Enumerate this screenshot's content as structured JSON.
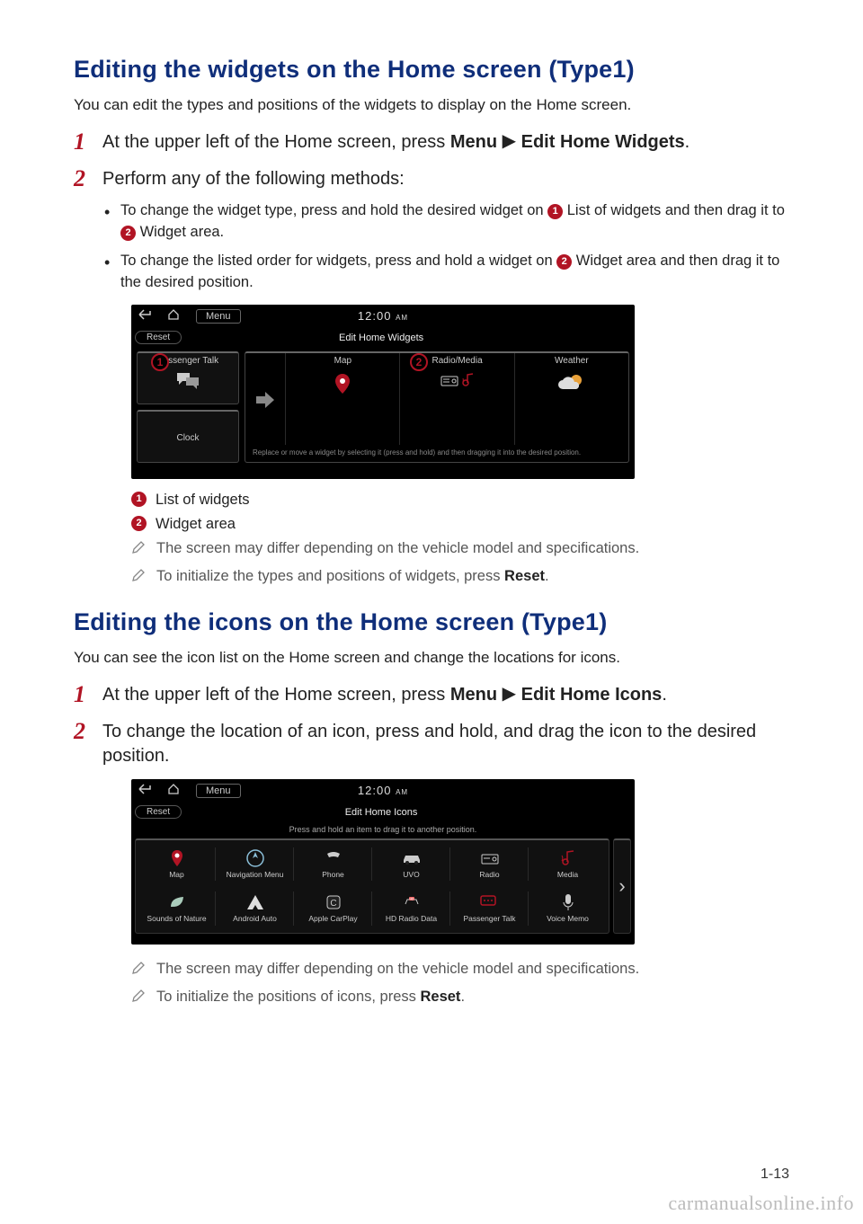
{
  "section1": {
    "heading": "Editing the widgets on the Home screen (Type1)",
    "lead": "You can edit the types and positions of the widgets to display on the Home screen.",
    "step1_pre": "At the upper left of the Home screen, press ",
    "step1_b1": "Menu",
    "arrow": "▶",
    "step1_b2": "Edit Home Widgets",
    "step1_post": ".",
    "step2": "Perform any of the following methods:",
    "sub1_a": "To change the widget type, press and hold the desired widget on ",
    "sub1_b": " List of widgets and then drag it to ",
    "sub1_c": " Widget area.",
    "sub2_a": "To change the listed order for widgets, press and hold a widget on ",
    "sub2_b": " Widget area and then drag it to the desired position.",
    "badge1": "1",
    "badge2": "2",
    "legend1": "List of widgets",
    "legend2": "Widget area",
    "note1": "The screen may differ depending on the vehicle model and specifications.",
    "note2_a": "To initialize the types and positions of widgets, press ",
    "note2_b": "Reset",
    "note2_c": "."
  },
  "shot1": {
    "menu": "Menu",
    "clock": "12:00",
    "ampm": "AM",
    "reset": "Reset",
    "title": "Edit Home Widgets",
    "left1": "Passenger Talk",
    "left2": "Clock",
    "c1": "Map",
    "c2": "Radio/Media",
    "c3": "Weather",
    "hint": "Replace or move a widget by selecting it (press and hold) and then dragging it into the desired position."
  },
  "section2": {
    "heading": "Editing the icons on the Home screen (Type1)",
    "lead": "You can see the icon list on the Home screen and change the locations for icons.",
    "step1_pre": "At the upper left of the Home screen, press ",
    "step1_b1": "Menu",
    "step1_b2": "Edit Home Icons",
    "step1_post": ".",
    "step2": "To change the location of an icon, press and hold, and drag the icon to the desired position.",
    "note1": "The screen may differ depending on the vehicle model and specifications.",
    "note2_a": "To initialize the positions of icons, press ",
    "note2_b": "Reset",
    "note2_c": "."
  },
  "shot2": {
    "menu": "Menu",
    "clock": "12:00",
    "ampm": "AM",
    "reset": "Reset",
    "title": "Edit Home Icons",
    "hint": "Press and hold an item to drag it to another position.",
    "items": {
      "i0": "Map",
      "i1": "Navigation Menu",
      "i2": "Phone",
      "i3": "UVO",
      "i4": "Radio",
      "i5": "Media",
      "i6": "Sounds of Nature",
      "i7": "Android Auto",
      "i8": "Apple CarPlay",
      "i9": "HD Radio Data",
      "i10": "Passenger Talk",
      "i11": "Voice Memo"
    }
  },
  "pagenum": "1-13",
  "watermark": "carmanualsonline.info"
}
